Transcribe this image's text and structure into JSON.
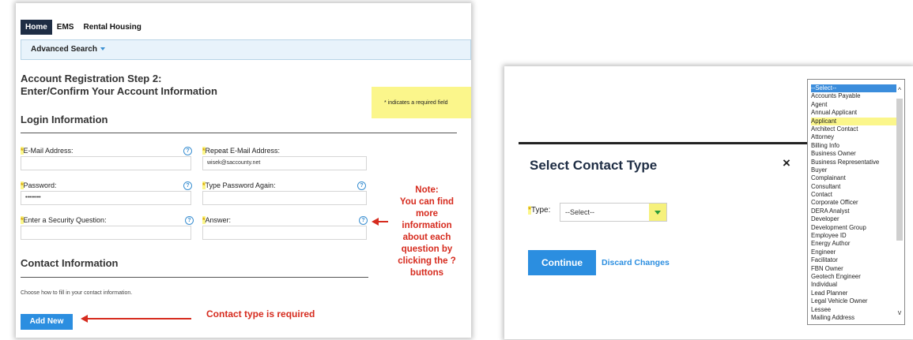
{
  "nav": {
    "tabs": [
      "Home",
      "EMS",
      "Rental Housing"
    ],
    "advanced": "Advanced Search"
  },
  "registration": {
    "title_line1": "Account Registration Step 2:",
    "title_line2": "Enter/Confirm Your Account Information",
    "required_note": "* indicates a required field",
    "login_heading": "Login Information",
    "fields": {
      "email": "E-Mail Address:",
      "repeat_email": "Repeat E-Mail Address:",
      "repeat_email_value": "wisek@saccounty.net",
      "password": "Password:",
      "password_value": "••••••••",
      "type_password": "Type Password Again:",
      "security_question": "Enter a Security Question:",
      "answer": "Answer:"
    },
    "contact_heading": "Contact Information",
    "choose_text": "Choose how to fill in your contact information.",
    "add_new": "Add New",
    "annotation_contact": "Contact type is required",
    "note_lines": [
      "Note:",
      "You can find",
      "more",
      "information",
      "about each",
      "question by",
      "clicking the ?",
      "buttons"
    ]
  },
  "modal": {
    "title": "Select Contact Type",
    "close": "×",
    "type_label": "Type:",
    "type_value": "--Select--",
    "continue": "Continue",
    "discard": "Discard Changes"
  },
  "contact_types": [
    "--Select--",
    "Accounts Payable",
    "Agent",
    "Annual Applicant",
    "Applicant",
    "Architect Contact",
    "Attorney",
    "Billing Info",
    "Business Owner",
    "Business Representative",
    "Buyer",
    "Complainant",
    "Consultant",
    "Contact",
    "Corporate Officer",
    "DERA Analyst",
    "Developer",
    "Development Group",
    "Employee ID",
    "Energy Author",
    "Engineer",
    "Facilitator",
    "FBN Owner",
    "Geotech Engineer",
    "Individual",
    "Lead Planner",
    "Legal Vehicle Owner",
    "Lessee",
    "Mailing Address"
  ],
  "colors": {
    "accent_blue": "#2b8ee0",
    "annotation_red": "#d62b1e",
    "highlight_yellow": "#fbf68b",
    "nav_dark": "#1e2d44"
  }
}
